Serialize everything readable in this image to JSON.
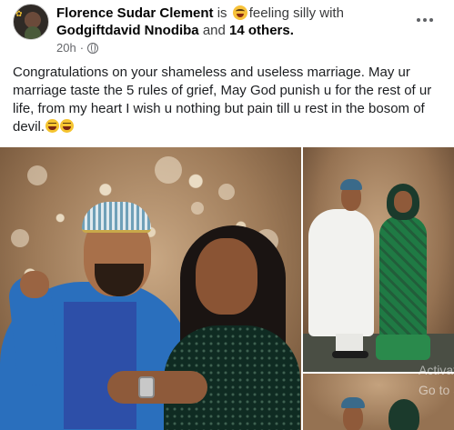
{
  "post": {
    "author": "Florence Sudar Clement",
    "connector_is": "is",
    "feeling_emoji_icon": "grinning-tongue-face-icon",
    "feeling_text": "feeling silly with",
    "tagged_user": "Godgiftdavid Nnodiba",
    "connector_and": "and",
    "others": "14 others.",
    "time": "20h",
    "privacy_icon": "globe-icon",
    "more_icon": "more-horizontal-icon",
    "text": "Congratulations on your shameless and useless marriage. May ur marriage taste the 5 rules of grief,  May God punish u for the rest of ur life, from my heart I wish u nothing but pain till u rest in the bosom of devil.",
    "trailing_emojis": [
      "grinning-face-icon",
      "grinning-face-icon"
    ]
  },
  "photos": [
    {
      "name": "couple-closeup-photo"
    },
    {
      "name": "couple-fullbody-photo"
    },
    {
      "name": "couple-partial-photo"
    }
  ],
  "watermark": {
    "line1": "Activate Windows",
    "line2": "Go to Settings to activate Windows."
  }
}
